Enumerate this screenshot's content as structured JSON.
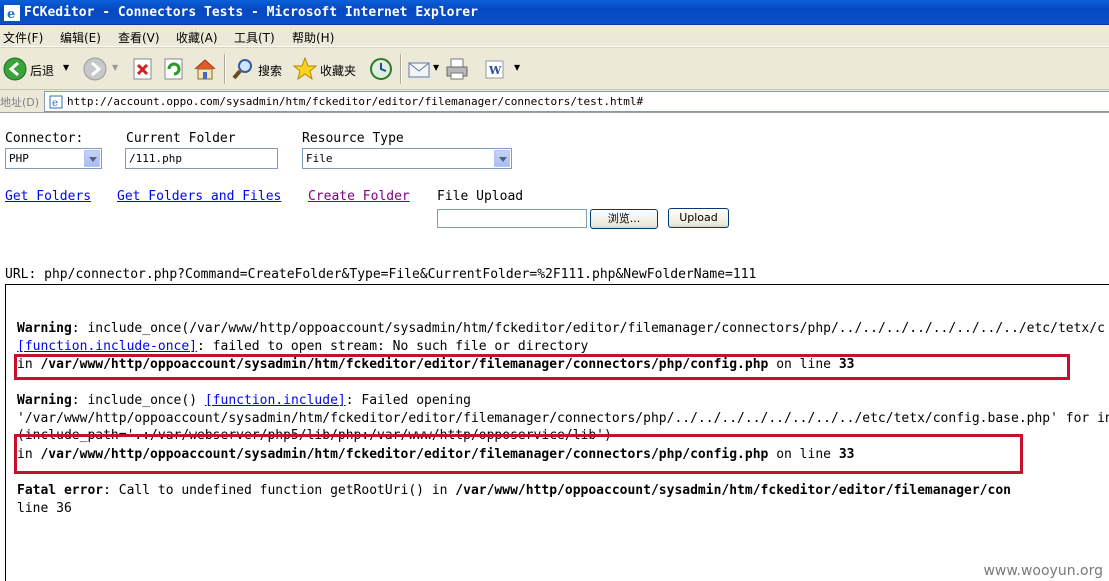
{
  "window": {
    "title": "FCKeditor - Connectors Tests - Microsoft Internet Explorer"
  },
  "menu": [
    "文件(F)",
    "编辑(E)",
    "查看(V)",
    "收藏(A)",
    "工具(T)",
    "帮助(H)"
  ],
  "toolbar": {
    "back": "后退",
    "search": "搜索",
    "favorites": "收藏夹"
  },
  "address": {
    "label": "地址(D)",
    "url": "http://account.oppo.com/sysadmin/htm/fckeditor/editor/filemanager/connectors/test.html#"
  },
  "form": {
    "connector_label": "Connector:",
    "connector_value": "PHP",
    "folder_label": "Current Folder",
    "folder_value": "/111.php",
    "resource_label": "Resource Type",
    "resource_value": "File",
    "get_folders": "Get Folders",
    "get_folders_files": "Get Folders and Files",
    "create_folder": "Create Folder",
    "file_upload_label": "File Upload",
    "browse": "浏览...",
    "upload": "Upload"
  },
  "request_url": "URL: php/connector.php?Command=CreateFolder&Type=File&CurrentFolder=%2F111.php&NewFolderName=111",
  "output": {
    "w1_label": "Warning",
    "w1_text": ": include_once(/var/www/http/oppoaccount/sysadmin/htm/fckeditor/editor/filemanager/connectors/php/../../../../../../../../etc/tetx/c",
    "w1_link": "[function.include-once]",
    "w1_text2": ": failed to open stream: No such file or directory",
    "w1_in": "in ",
    "w1_path": "/var/www/http/oppoaccount/sysadmin/htm/fckeditor/editor/filemanager/connectors/php/config.php",
    "w1_on": " on line ",
    "w1_line": "33",
    "w2_label": "Warning",
    "w2_text": ": include_once() ",
    "w2_link": "[function.include]",
    "w2_text2": ": Failed opening",
    "w2_text3": "'/var/www/http/oppoaccount/sysadmin/htm/fckeditor/editor/filemanager/connectors/php/../../../../../../../../etc/tetx/config.base.php' for in",
    "w2_text4": "(include_path='.:/var/webserver/php5/lib/php:/var/www/http/opposervice/lib')",
    "w2_in": "in ",
    "w2_path": "/var/www/http/oppoaccount/sysadmin/htm/fckeditor/editor/filemanager/connectors/php/config.php",
    "w2_on": " on line ",
    "w2_line": "33",
    "fatal_label": "Fatal error",
    "fatal_text": ": Call to undefined function getRootUri() in ",
    "fatal_path": "/var/www/http/oppoaccount/sysadmin/htm/fckeditor/editor/filemanager/con",
    "fatal_line": "line 36"
  },
  "watermark": "www.wooyun.org",
  "colors": {
    "highlight": "#c8102e",
    "link": "#0000ff",
    "visited": "#800080",
    "titlebar": "#0a5fd8"
  }
}
